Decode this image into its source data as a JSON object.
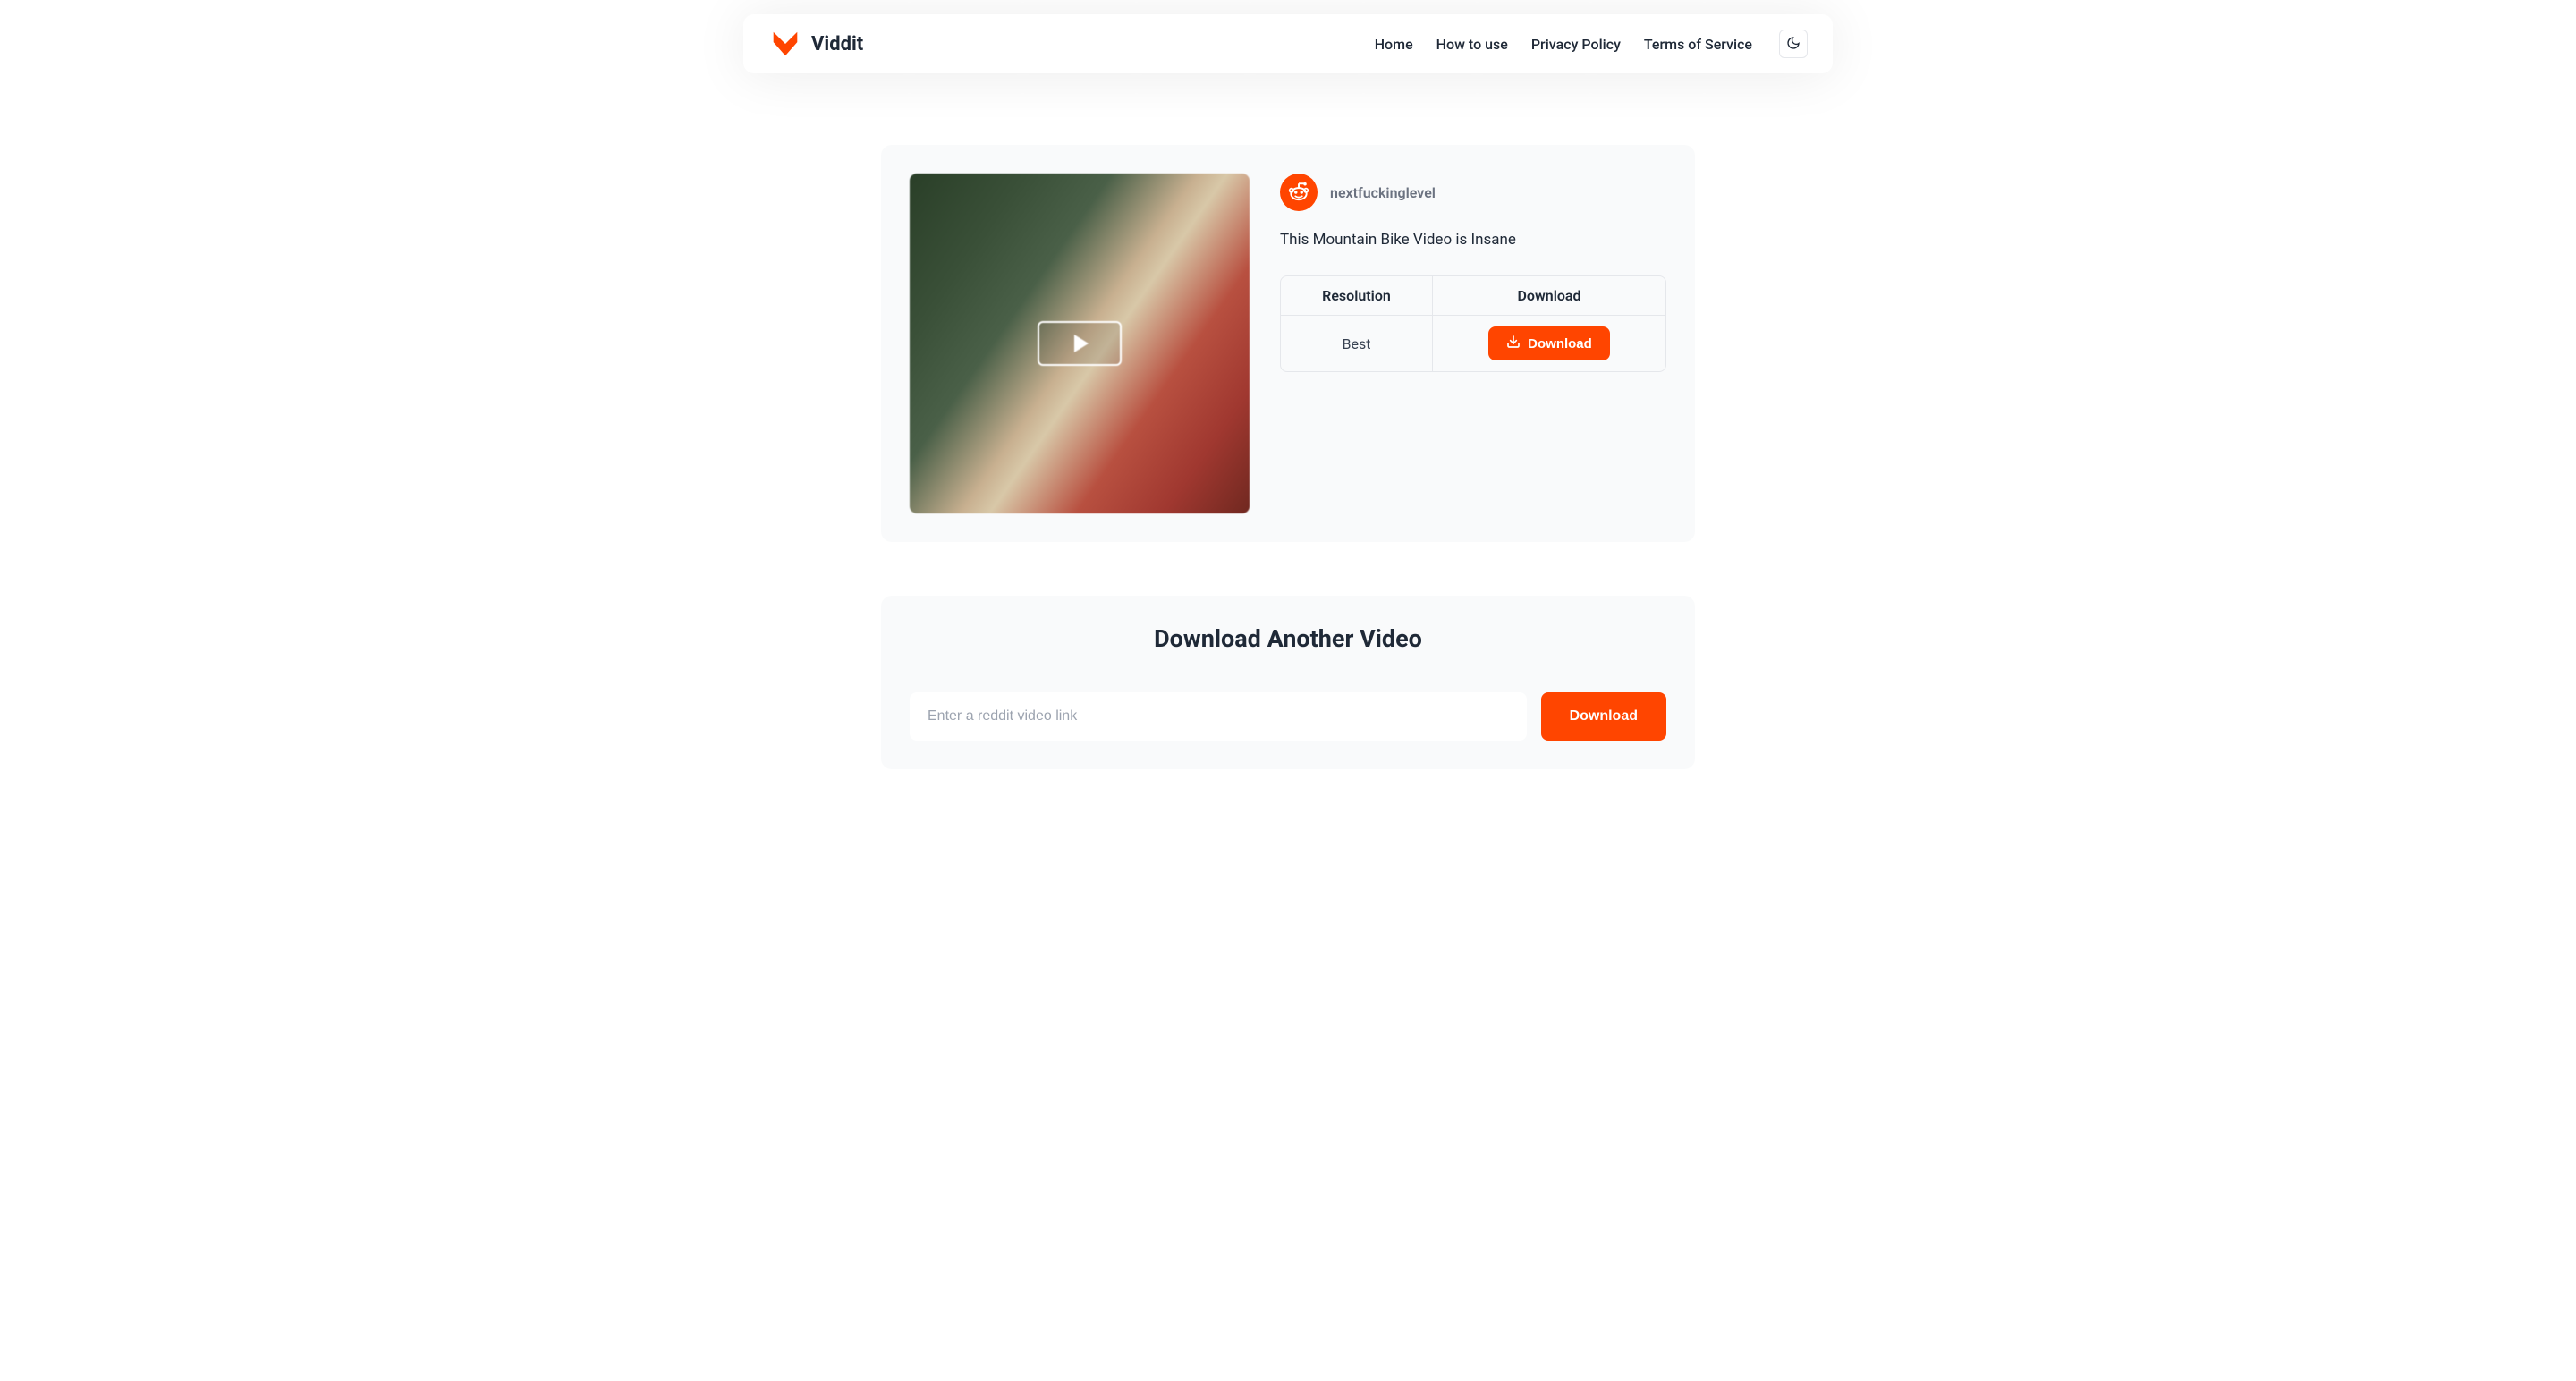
{
  "brand": {
    "name": "Viddit"
  },
  "nav": {
    "links": [
      {
        "label": "Home"
      },
      {
        "label": "How to use"
      },
      {
        "label": "Privacy Policy"
      },
      {
        "label": "Terms of Service"
      }
    ]
  },
  "video": {
    "subreddit": "nextfuckinglevel",
    "title": "This Mountain Bike Video is Insane"
  },
  "table": {
    "headers": {
      "resolution": "Resolution",
      "download": "Download"
    },
    "rows": [
      {
        "resolution": "Best",
        "button_label": "Download"
      }
    ]
  },
  "another": {
    "title": "Download Another Video",
    "placeholder": "Enter a reddit video link",
    "button": "Download"
  },
  "colors": {
    "accent": "#ff4500"
  }
}
